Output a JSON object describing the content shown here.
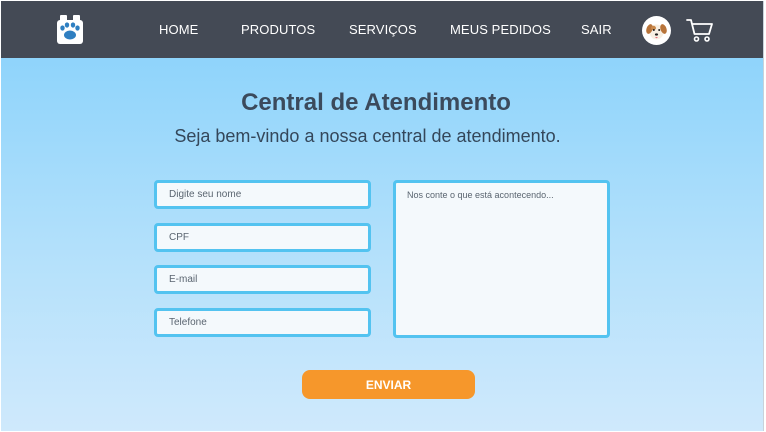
{
  "nav": {
    "logo_icon": "paw-print-icon",
    "links": [
      "HOME",
      "PRODUTOS",
      "SERVIÇOS",
      "MEUS PEDIDOS",
      "SAIR"
    ],
    "avatar_icon": "dog-face-icon",
    "cart_icon": "shopping-cart-icon"
  },
  "main": {
    "title": "Central de Atendimento",
    "subtitle": "Seja bem-vindo a nossa central de atendimento."
  },
  "form": {
    "name_placeholder": "Digite seu nome",
    "cpf_placeholder": "CPF",
    "email_placeholder": "E-mail",
    "phone_placeholder": "Telefone",
    "message_placeholder": "Nos conte o que está acontecendo...",
    "submit_label": "ENVIAR"
  },
  "colors": {
    "navbar": "#444a55",
    "field_border": "#53c3f0",
    "button": "#f6972b"
  }
}
